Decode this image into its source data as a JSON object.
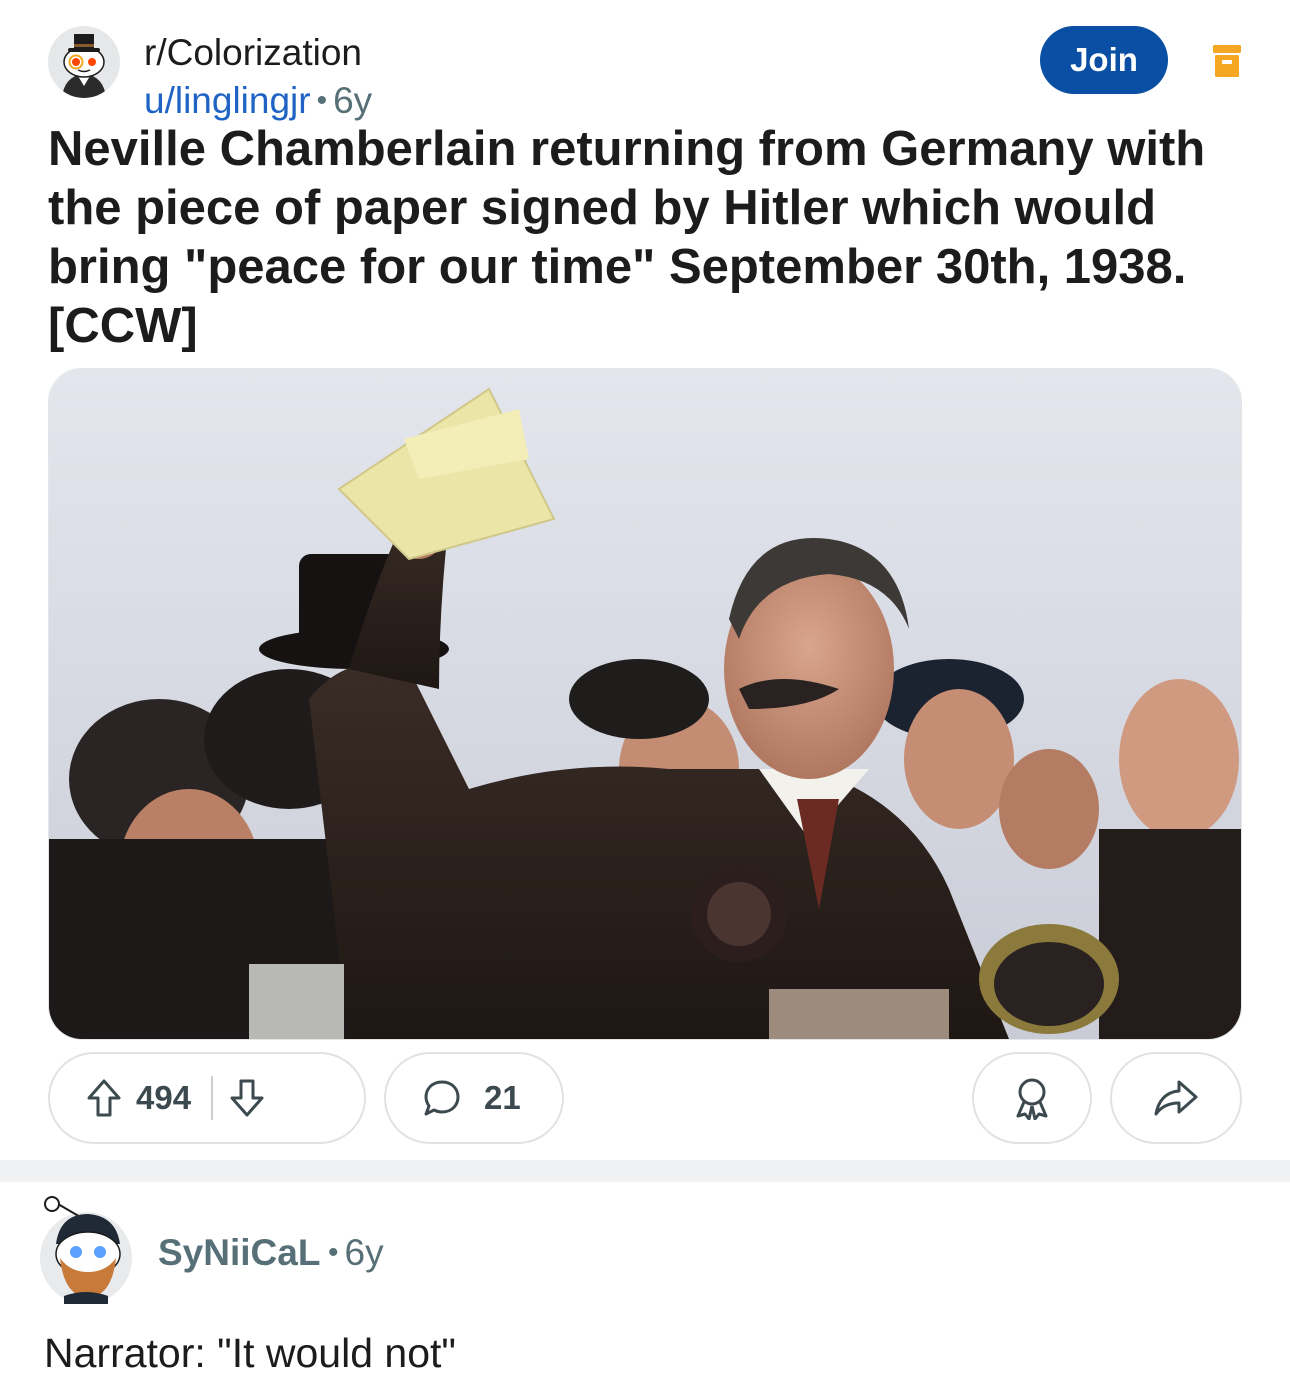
{
  "post": {
    "subreddit": "r/Colorization",
    "author": "u/linglingjr",
    "separator": "•",
    "age": "6y",
    "join_label": "Join",
    "title": "Neville Chamberlain returning from Germany with the piece of paper signed by Hitler which would bring \"peace for our time\" September 30th, 1938. [CCW]",
    "photo_icon": "colorized-photo",
    "upvotes": "494",
    "comments": "21"
  },
  "icons": {
    "subreddit_avatar": "snoo-top-hat-avatar",
    "archive": "archive-icon",
    "upvote": "arrow-up-icon",
    "downvote": "arrow-down-icon",
    "comment": "speech-bubble-icon",
    "award": "award-ribbon-icon",
    "share": "share-arrow-icon"
  },
  "comment": {
    "author": "SyNiiCaL",
    "separator": "•",
    "age": "6y",
    "body": "Narrator: \"It would not\""
  },
  "colors": {
    "join_button": "#0a4fa4",
    "user_link": "#1f63c4",
    "archive_icon": "#f5a623",
    "muted_text": "#576f76"
  }
}
